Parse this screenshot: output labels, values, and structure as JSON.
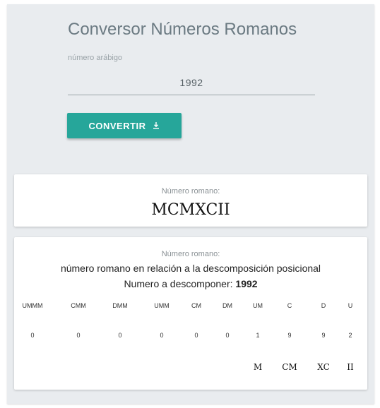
{
  "header": {
    "title": "Conversor Números Romanos"
  },
  "input": {
    "label": "número arábigo",
    "value": "1992"
  },
  "button": {
    "label": "CONVERTIR",
    "icon": "download-icon"
  },
  "result": {
    "label": "Número romano:",
    "value": "MCMXCII"
  },
  "breakdown": {
    "label": "Número romano:",
    "description": "número romano en relación a la descomposición posicional",
    "number_prefix": "Numero a descomponer: ",
    "number_value": "1992",
    "columns": [
      {
        "header": "UMMM",
        "digit": "0",
        "roman": ""
      },
      {
        "header": "CMM",
        "digit": "0",
        "roman": ""
      },
      {
        "header": "DMM",
        "digit": "0",
        "roman": ""
      },
      {
        "header": "UMM",
        "digit": "0",
        "roman": ""
      },
      {
        "header": "CM",
        "digit": "0",
        "roman": ""
      },
      {
        "header": "DM",
        "digit": "0",
        "roman": ""
      },
      {
        "header": "UM",
        "digit": "1",
        "roman": "M"
      },
      {
        "header": "C",
        "digit": "9",
        "roman": "CM"
      },
      {
        "header": "D",
        "digit": "9",
        "roman": "XC"
      },
      {
        "header": "U",
        "digit": "2",
        "roman": "II"
      }
    ]
  },
  "colors": {
    "accent": "#26a69a",
    "background": "#e9ecef"
  }
}
